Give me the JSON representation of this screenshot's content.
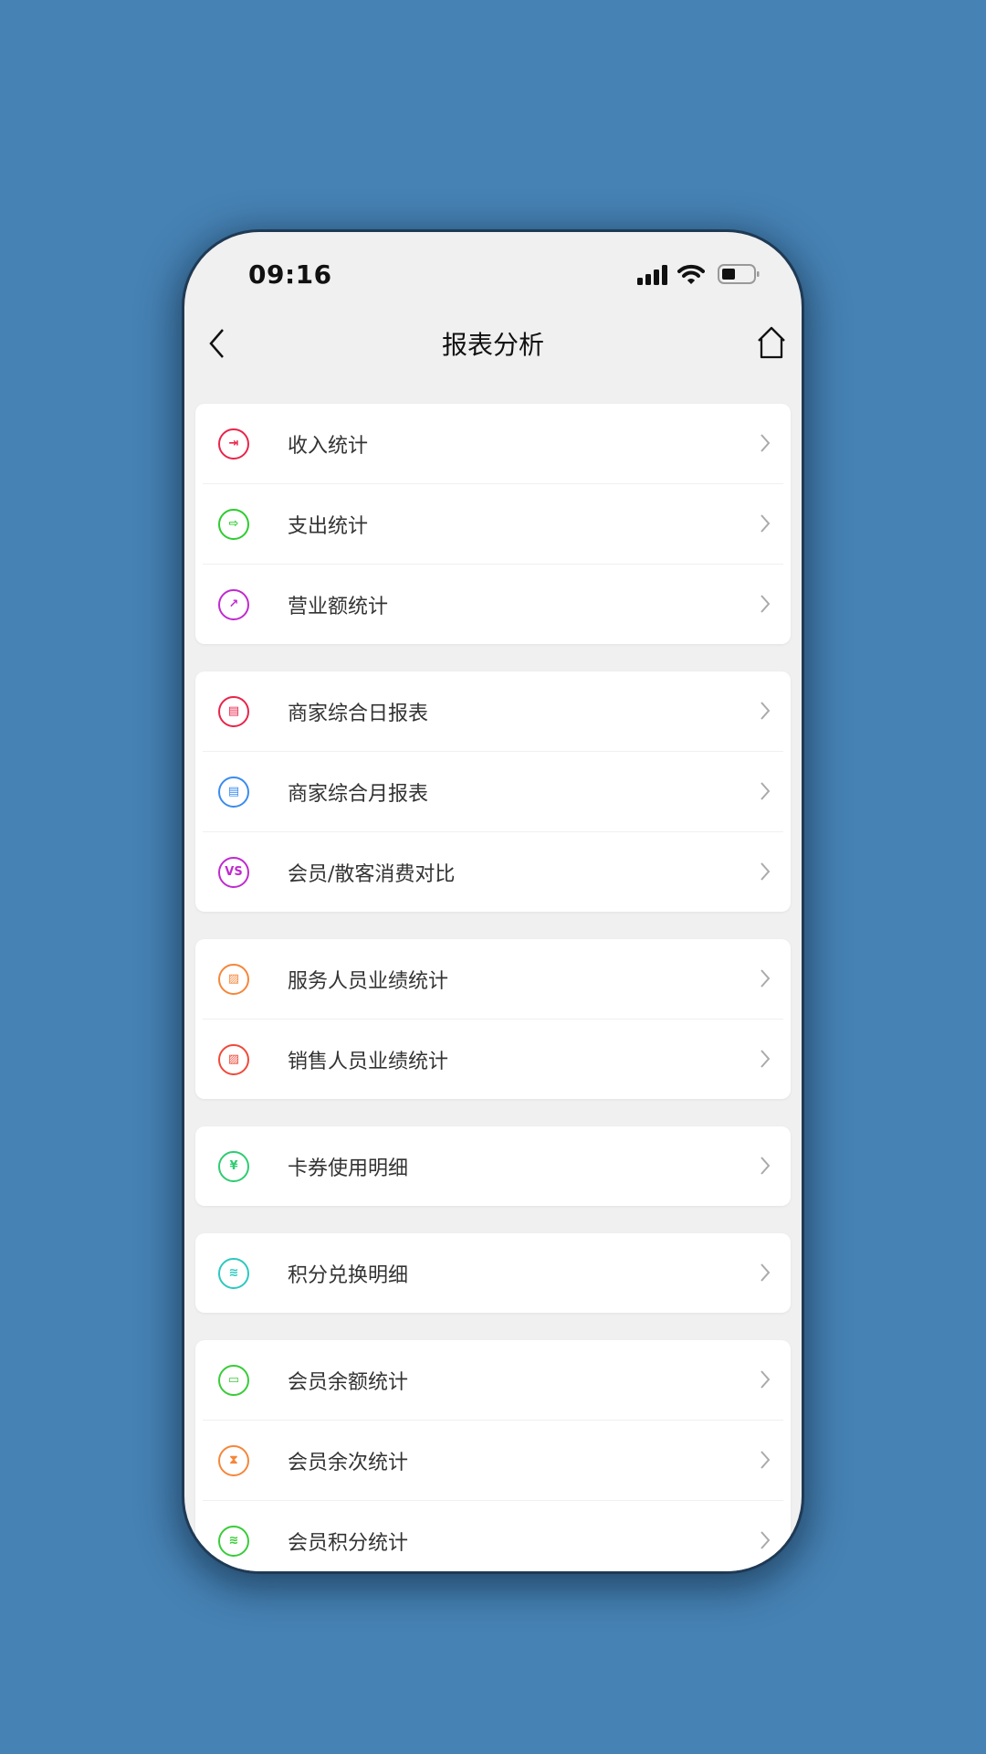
{
  "status_bar": {
    "time": "09:16"
  },
  "nav": {
    "title": "报表分析",
    "back_icon": "chevron-left-icon",
    "home_icon": "home-icon"
  },
  "groups": [
    {
      "items": [
        {
          "label": "收入统计",
          "icon": "login-icon",
          "color": "#e8254a",
          "glyph": "⇥"
        },
        {
          "label": "支出统计",
          "icon": "logout-icon",
          "color": "#2ecc2e",
          "glyph": "⇨"
        },
        {
          "label": "营业额统计",
          "icon": "trend-chart-icon",
          "color": "#c02ad0",
          "glyph": "↗"
        }
      ]
    },
    {
      "items": [
        {
          "label": "商家综合日报表",
          "icon": "calendar-day-icon",
          "color": "#e8254a",
          "glyph": "▤"
        },
        {
          "label": "商家综合月报表",
          "icon": "calendar-month-icon",
          "color": "#3a8cf0",
          "glyph": "▤"
        },
        {
          "label": "会员/散客消费对比",
          "icon": "vs-icon",
          "color": "#c02ad0",
          "glyph": "VS"
        }
      ]
    },
    {
      "items": [
        {
          "label": "服务人员业绩统计",
          "icon": "line-chart-icon",
          "color": "#f5873a",
          "glyph": "▨"
        },
        {
          "label": "销售人员业绩统计",
          "icon": "line-chart-icon",
          "color": "#f04a3a",
          "glyph": "▨"
        }
      ]
    },
    {
      "items": [
        {
          "label": "卡券使用明细",
          "icon": "coupon-icon",
          "color": "#2ecc71",
          "glyph": "¥"
        }
      ]
    },
    {
      "items": [
        {
          "label": "积分兑换明细",
          "icon": "coins-stack-icon",
          "color": "#2ec8c0",
          "glyph": "≋"
        }
      ]
    },
    {
      "items": [
        {
          "label": "会员余额统计",
          "icon": "wallet-icon",
          "color": "#3acc3a",
          "glyph": "▭"
        },
        {
          "label": "会员余次统计",
          "icon": "hourglass-icon",
          "color": "#f5873a",
          "glyph": "⧗"
        },
        {
          "label": "会员积分统计",
          "icon": "coins-stack-icon",
          "color": "#3acc3a",
          "glyph": "≋"
        }
      ]
    }
  ]
}
